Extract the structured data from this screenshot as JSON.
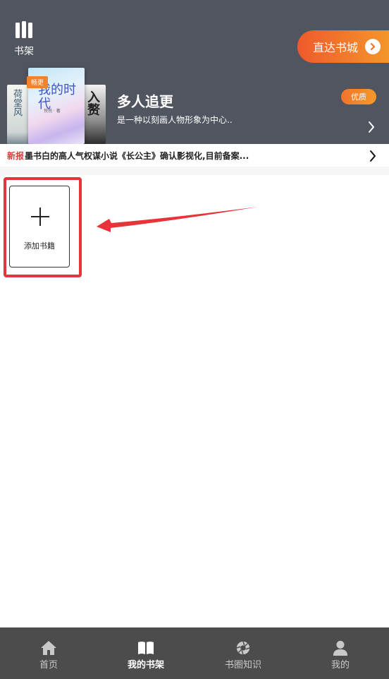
{
  "header": {
    "shelf_label": "书架",
    "store_button": "直达书城"
  },
  "featured": {
    "rank_badge": "畅更",
    "title": "多人追更",
    "description": "是一种以刻画人物形象为中心..",
    "quality_badge": "优质",
    "covers": [
      {
        "title": "荷堂风"
      },
      {
        "title": "我的时代",
        "author": "悦悦 · 著"
      },
      {
        "title": "入赘"
      }
    ]
  },
  "news": {
    "tag": "新报",
    "text": "墨书白的高人气权谋小说《长公主》确认影视化,目前备案..."
  },
  "shelf": {
    "add_label": "添加书籍"
  },
  "tabs": [
    {
      "label": "首页",
      "icon": "home-icon"
    },
    {
      "label": "我的书架",
      "icon": "book-icon",
      "active": true
    },
    {
      "label": "书圈知识",
      "icon": "aperture-icon"
    },
    {
      "label": "我的",
      "icon": "user-icon"
    }
  ],
  "colors": {
    "header_bg": "#505560",
    "accent": "#f2732a",
    "annotation_red": "#e8333b",
    "tabbar_bg": "#4c4c4c"
  }
}
